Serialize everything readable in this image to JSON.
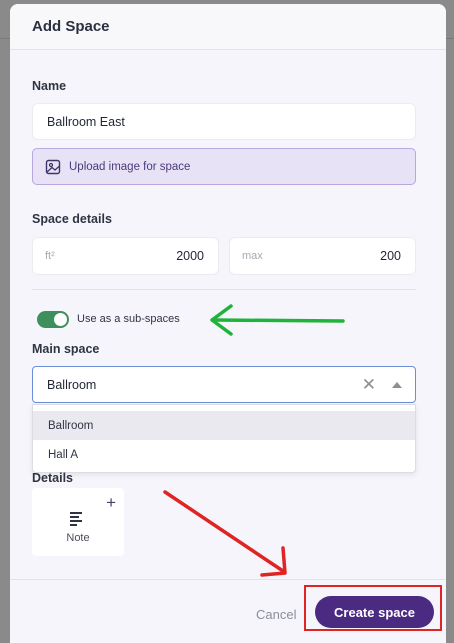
{
  "modal": {
    "title": "Add Space",
    "name_label": "Name",
    "name_value": "Ballroom East",
    "upload_label": "Upload image for space",
    "space_details_label": "Space details",
    "area_unit": "ft²",
    "area_value": "2000",
    "capacity_unit": "max",
    "capacity_value": "200",
    "sub_space_toggle_label": "Use as a sub-spaces",
    "sub_space_enabled": true,
    "main_space_label": "Main space",
    "main_space_value": "Ballroom",
    "main_space_options": [
      "Ballroom",
      "Hall A"
    ],
    "details_label": "Details",
    "note_label": "Note",
    "cancel_label": "Cancel",
    "create_label": "Create space"
  },
  "colors": {
    "primary": "#4b2a82",
    "toggle_on": "#3d8f5c",
    "annotation_green": "#1fb33a",
    "annotation_red": "#e02323"
  }
}
